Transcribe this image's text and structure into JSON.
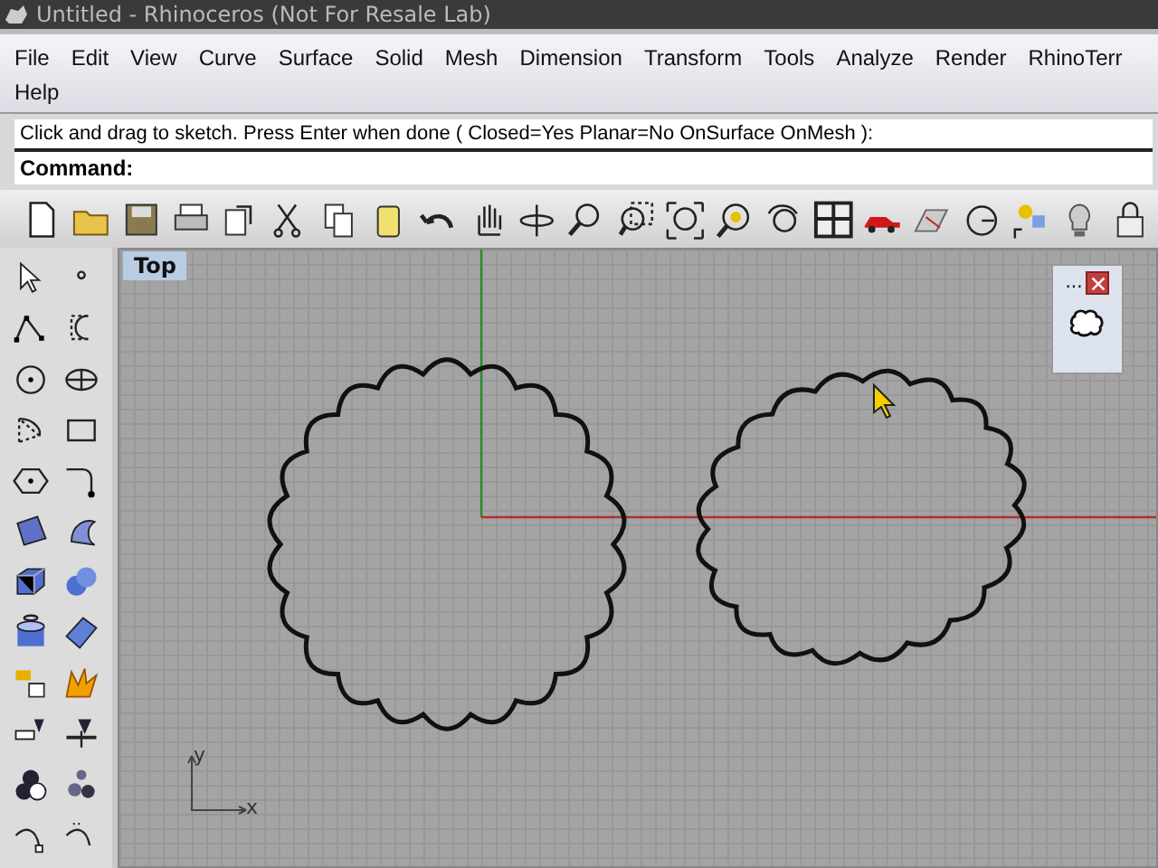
{
  "window": {
    "title": "Untitled - Rhinoceros (Not For Resale Lab)"
  },
  "menu_rows": [
    [
      "File",
      "Edit",
      "View",
      "Curve",
      "Surface",
      "Solid",
      "Mesh",
      "Dimension",
      "Transform",
      "Tools",
      "Analyze",
      "Render",
      "RhinoTerr"
    ],
    [
      "Help"
    ]
  ],
  "command_history": "Click and drag to sketch. Press Enter when done ( Closed=Yes  Planar=No  OnSurface  OnMesh ):",
  "command_prompt": "Command:",
  "viewport": {
    "title": "Top",
    "axis_labels": {
      "x": "x",
      "y": "y"
    }
  },
  "floating_panel": {
    "title": "..."
  }
}
